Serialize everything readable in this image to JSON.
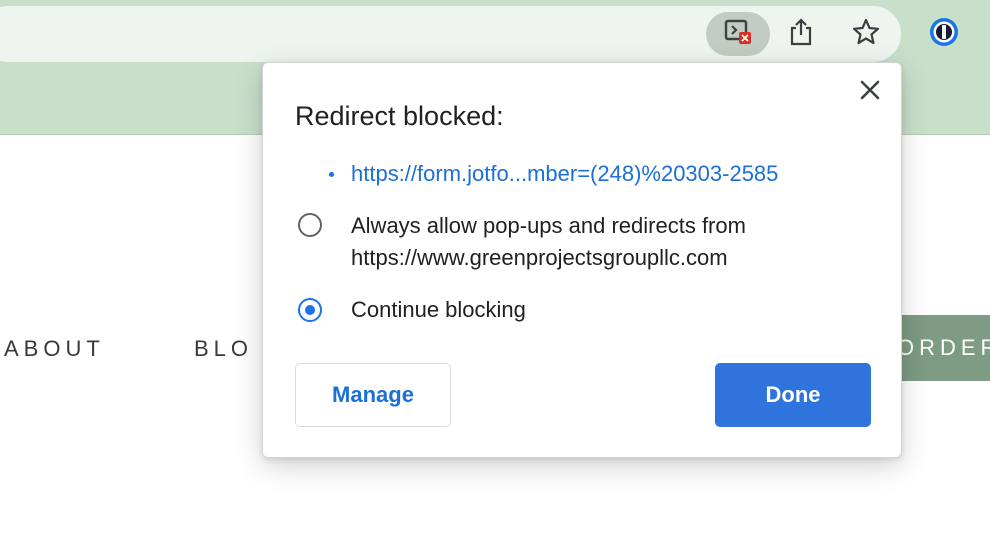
{
  "browser": {
    "icons": {
      "popup_blocked": "popup-blocked-icon",
      "share": "share-icon",
      "bookmark": "star-icon",
      "extension": "onepassword-icon"
    },
    "colors": {
      "chrome_bg": "#c8e0ca",
      "accent": "#1a73e8"
    }
  },
  "website": {
    "nav": {
      "about": "ABOUT",
      "blog": "BLO",
      "order": "ORDER"
    }
  },
  "dialog": {
    "title": "Redirect blocked:",
    "blocked_url": "https://form.jotfo...mber=(248)%20303-2585",
    "options": {
      "allow_line1": "Always allow pop-ups and redirects from",
      "allow_line2": "https://www.greenprojectsgroupllc.com",
      "block": "Continue blocking"
    },
    "selected_option": "block",
    "manage_label": "Manage",
    "done_label": "Done"
  }
}
